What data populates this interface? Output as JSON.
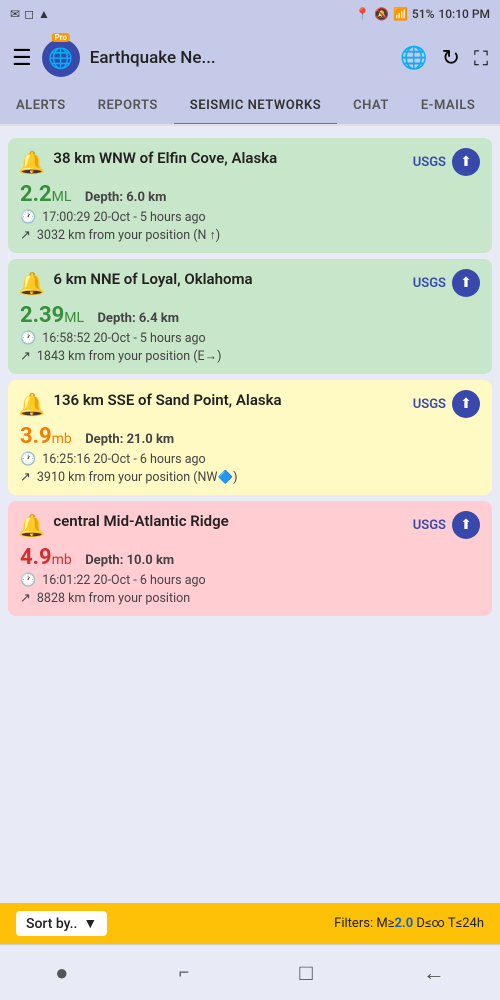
{
  "statusBar": {
    "leftIcons": [
      "✉",
      "◻",
      "▲"
    ],
    "location": "📍",
    "signal": "📶",
    "battery": "51%",
    "time": "10:10 PM"
  },
  "header": {
    "menuLabel": "☰",
    "globeIcon": "🌐",
    "proLabel": "Pro",
    "title": "Earthquake Ne...",
    "worldIcon": "🌐",
    "refreshIcon": "↻",
    "expandIcon": "⛶"
  },
  "tabs": [
    {
      "id": "alerts",
      "label": "ALERTS",
      "active": false
    },
    {
      "id": "reports",
      "label": "REPORTS",
      "active": false
    },
    {
      "id": "seismic",
      "label": "SEISMIC NETWORKS",
      "active": true
    },
    {
      "id": "chat",
      "label": "CHAT",
      "active": false
    },
    {
      "id": "emails",
      "label": "E-MAILS",
      "active": false
    }
  ],
  "earthquakes": [
    {
      "id": "eq1",
      "icon": "🔔",
      "title": "38 km WNW of Elfin Cove, Alaska",
      "source": "USGS",
      "magnitude": "2.2",
      "magUnit": "ML",
      "magColor": "green",
      "depth": "Depth: 6.0 km",
      "time": "17:00:29 20-Oct - 5 hours ago",
      "distance": "3032 km from your position (N ↑)",
      "cardColor": "green"
    },
    {
      "id": "eq2",
      "icon": "🔔",
      "title": "6 km NNE of Loyal, Oklahoma",
      "source": "USGS",
      "magnitude": "2.39",
      "magUnit": "ML",
      "magColor": "green",
      "depth": "Depth: 6.4 km",
      "time": "16:58:52 20-Oct - 5 hours ago",
      "distance": "1843 km from your position (E→)",
      "cardColor": "green"
    },
    {
      "id": "eq3",
      "icon": "🔔",
      "title": "136 km SSE of Sand Point, Alaska",
      "source": "USGS",
      "magnitude": "3.9",
      "magUnit": "mb",
      "magColor": "orange",
      "depth": "Depth: 21.0 km",
      "time": "16:25:16 20-Oct - 6 hours ago",
      "distance": "3910 km from your position (NW🔷)",
      "cardColor": "yellow"
    },
    {
      "id": "eq4",
      "icon": "🔔",
      "title": "central Mid-Atlantic Ridge",
      "source": "USGS",
      "magnitude": "4.9",
      "magUnit": "mb",
      "magColor": "red",
      "depth": "Depth: 10.0 km",
      "time": "16:01:22 20-Oct - 6 hours ago",
      "distance": "8828 km from your position",
      "cardColor": "red"
    }
  ],
  "bottomBar": {
    "sortLabel": "Sort by..",
    "filterText": "Filters: M≥",
    "filterMag": "2.0",
    "filterMore": " D≤∞ T≤24h"
  },
  "navBar": {
    "icons": [
      "●",
      "⌐",
      "□",
      "←"
    ]
  }
}
